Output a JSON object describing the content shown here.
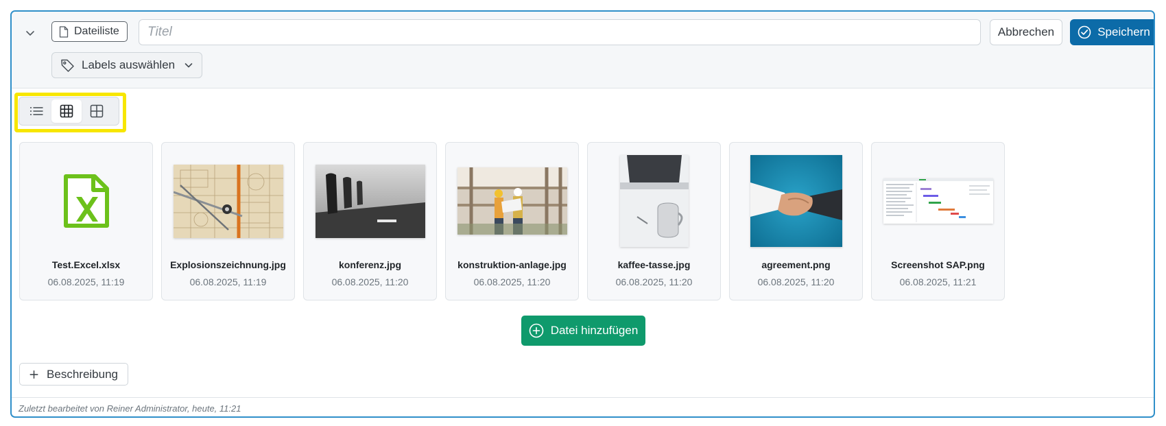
{
  "header": {
    "type_badge_label": "Dateiliste",
    "title_placeholder": "Titel",
    "title_value": "",
    "cancel_label": "Abbrechen",
    "save_label": "Speichern",
    "labels_label": "Labels auswählen"
  },
  "view_switch": {
    "options": [
      "list-view",
      "table-view",
      "grid-view"
    ],
    "active": "table-view"
  },
  "files": [
    {
      "name": "Test.Excel.xlsx",
      "date": "06.08.2025, 11:19",
      "icon": "excel-file-icon"
    },
    {
      "name": "Explosionszeichnung.jpg",
      "date": "06.08.2025, 11:19"
    },
    {
      "name": "konferenz.jpg",
      "date": "06.08.2025, 11:20"
    },
    {
      "name": "konstruktion-anlage.jpg",
      "date": "06.08.2025, 11:20"
    },
    {
      "name": "kaffee-tasse.jpg",
      "date": "06.08.2025, 11:20"
    },
    {
      "name": "agreement.png",
      "date": "06.08.2025, 11:20"
    },
    {
      "name": "Screenshot SAP.png",
      "date": "06.08.2025, 11:21"
    }
  ],
  "actions": {
    "add_file_label": "Datei hinzufügen",
    "description_label": "Beschreibung"
  },
  "footer": {
    "text": "Zuletzt bearbeitet von Reiner Administrator, heute, 11:21"
  },
  "colors": {
    "border_accent": "#2f8fc9",
    "save": "#0c6ba8",
    "add_file": "#0f9a6c",
    "highlight": "#f7e600",
    "excel": "#6cc11b"
  }
}
